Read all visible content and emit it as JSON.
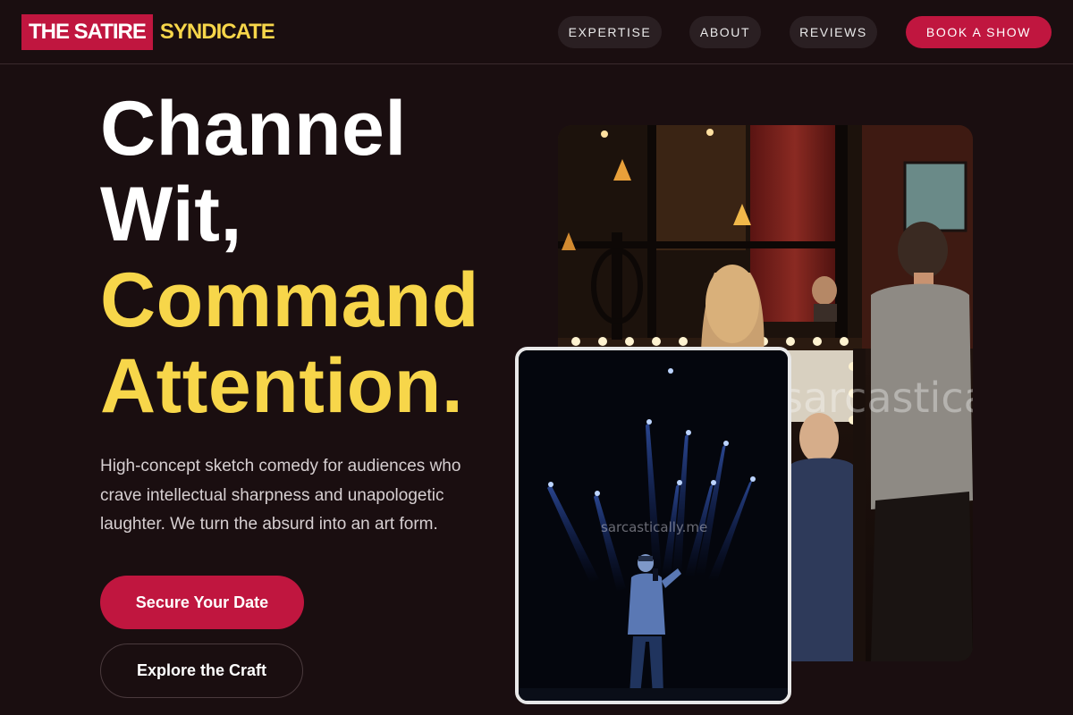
{
  "header": {
    "logo": {
      "box_text": "THE SATIRE",
      "rest_text": "SYNDICATE"
    },
    "nav": [
      {
        "label": "EXPERTISE"
      },
      {
        "label": "ABOUT"
      },
      {
        "label": "REVIEWS"
      }
    ],
    "cta_label": "BOOK A SHOW"
  },
  "hero": {
    "headline": {
      "line1": "Channel",
      "line2": "Wit,",
      "line3": "Command",
      "line4": "Attention."
    },
    "subtitle": "High-concept sketch comedy for audiences who crave intellectual sharpness and unapologetic laughter. We turn the absurd into an art form.",
    "primary_button": "Secure Your Date",
    "secondary_button": "Explore the Craft"
  },
  "images": {
    "back_watermark": "sarcastically.me",
    "front_watermark": "sarcastically.me"
  },
  "colors": {
    "background": "#1a0e10",
    "accent_red": "#c0163f",
    "accent_yellow": "#f7d64a",
    "nav_pill": "#2a1f22"
  }
}
